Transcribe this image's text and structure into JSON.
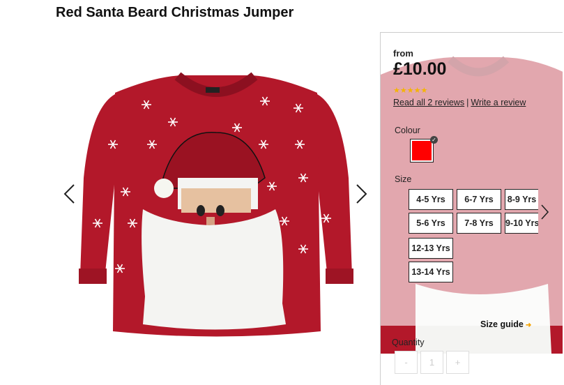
{
  "product": {
    "title": "Red Santa Beard Christmas Jumper"
  },
  "gallery": {
    "prev_icon": "chevron-left-icon",
    "next_icon": "chevron-right-icon"
  },
  "panel": {
    "from_label": "from",
    "price": "£10.00",
    "stars": "★★★★★",
    "rating": 5,
    "read_reviews": "Read all 2 reviews",
    "separator": "|",
    "write_review": "Write a review",
    "colour_label": "Colour",
    "colour_selected": "#ff0000",
    "colour_check": "✓",
    "size_label": "Size",
    "sizes": [
      "4-5 Yrs",
      "6-7 Yrs",
      "8-9 Yrs",
      "5-6 Yrs",
      "7-8 Yrs",
      "9-10 Yrs",
      "12-13 Yrs",
      "13-14 Yrs"
    ],
    "size_guide": "Size guide",
    "size_guide_arrow": "➜",
    "quantity_label": "Quantity",
    "qty_minus": "-",
    "qty_value": "1",
    "qty_plus": "+"
  },
  "colors": {
    "accent": "#f5a300",
    "jumper_red": "#b3182a",
    "beard_white": "#f4f4f2"
  }
}
